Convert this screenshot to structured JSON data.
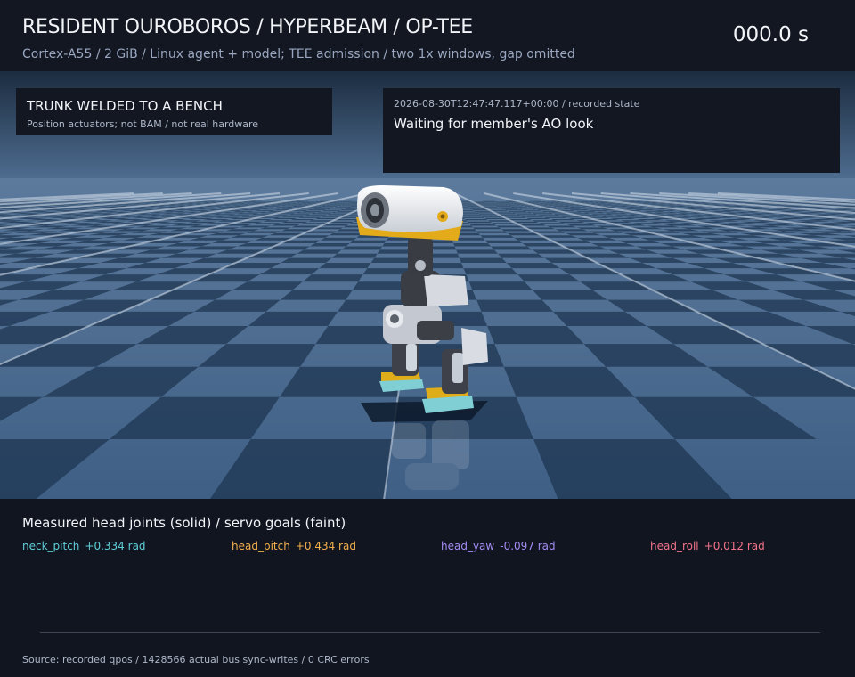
{
  "header": {
    "title": "RESIDENT OUROBOROS / HYPERBEAM / OP-TEE",
    "subtitle": "Cortex-A55 / 2 GiB / Linux agent + model; TEE admission / two 1x windows, gap omitted",
    "timer": "000.0 s"
  },
  "panel_left": {
    "title": "TRUNK WELDED TO A BENCH",
    "note": "Position actuators; not BAM / not real hardware"
  },
  "panel_right": {
    "timestamp": "2026-08-30T12:47:47.117+00:00 / recorded state",
    "status": "Waiting for member's AO look"
  },
  "joints": {
    "title": "Measured head joints (solid) / servo goals (faint)",
    "items": [
      {
        "name": "neck_pitch",
        "value": "+0.334 rad",
        "color": "#5fd0d8"
      },
      {
        "name": "head_pitch",
        "value": "+0.434 rad",
        "color": "#f5b04c"
      },
      {
        "name": "head_yaw",
        "value": "-0.097 rad",
        "color": "#a48cf5"
      },
      {
        "name": "head_roll",
        "value": "+0.012 rad",
        "color": "#f2738a"
      }
    ]
  },
  "footer": {
    "source": "Source: recorded qpos / 1428566 actual bus sync-writes / 0 CRC errors"
  }
}
